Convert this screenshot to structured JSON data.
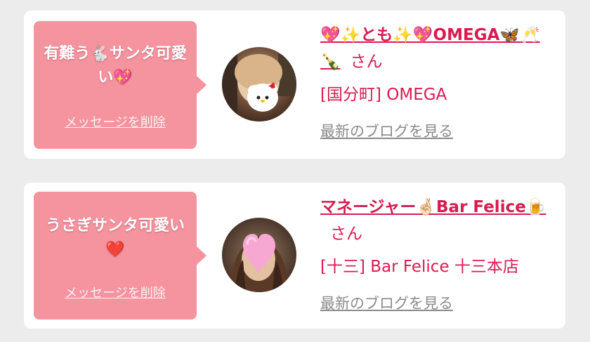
{
  "items": [
    {
      "message": "有難う🐇サンタ可愛い💖",
      "delete_label": "メッセージを削除",
      "cast_name": "💖✨とも✨💖OMEGA🦋🥂🍾",
      "honorific": "さん",
      "shop": "[国分町] OMEGA",
      "blog_link": "最新のブログを見る"
    },
    {
      "message": "うさぎサンタ可愛い❤️",
      "delete_label": "メッセージを削除",
      "cast_name": "マネージャー🤞🏻Bar Felice🍺",
      "honorific": "さん",
      "shop": "[十三] Bar Felice 十三本店",
      "blog_link": "最新のブログを見る"
    }
  ]
}
